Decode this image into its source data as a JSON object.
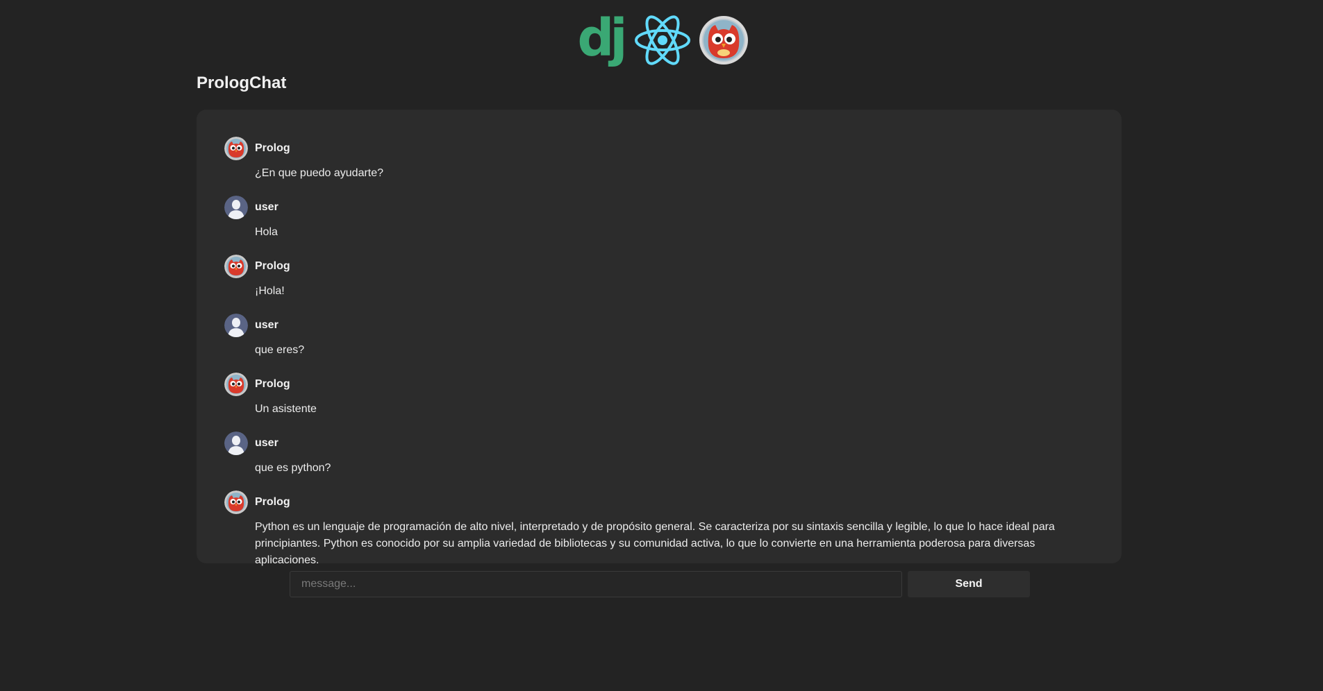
{
  "header": {
    "logos": [
      "django-logo",
      "react-logo",
      "prolog-owl-logo"
    ],
    "django_text": "dj"
  },
  "page_title": "PrologChat",
  "colors": {
    "background": "#232323",
    "panel": "#2c2c2c",
    "django_green": "#3aa874",
    "react_cyan": "#61dafb"
  },
  "messages": [
    {
      "author": "Prolog",
      "avatar": "owl-avatar-icon",
      "text": "¿En que puedo ayudarte?"
    },
    {
      "author": "user",
      "avatar": "user-avatar-icon",
      "text": "Hola"
    },
    {
      "author": "Prolog",
      "avatar": "owl-avatar-icon",
      "text": "¡Hola!"
    },
    {
      "author": "user",
      "avatar": "user-avatar-icon",
      "text": "que eres?"
    },
    {
      "author": "Prolog",
      "avatar": "owl-avatar-icon",
      "text": "Un asistente"
    },
    {
      "author": "user",
      "avatar": "user-avatar-icon",
      "text": "que es python?"
    },
    {
      "author": "Prolog",
      "avatar": "owl-avatar-icon",
      "text": "Python es un lenguaje de programación de alto nivel, interpretado y de propósito general. Se caracteriza por su sintaxis sencilla y legible, lo que lo hace ideal para principiantes. Python es conocido por su amplia variedad de bibliotecas y su comunidad activa, lo que lo convierte en una herramienta poderosa para diversas aplicaciones."
    }
  ],
  "composer": {
    "value": "",
    "placeholder": "message...",
    "send_label": "Send"
  }
}
